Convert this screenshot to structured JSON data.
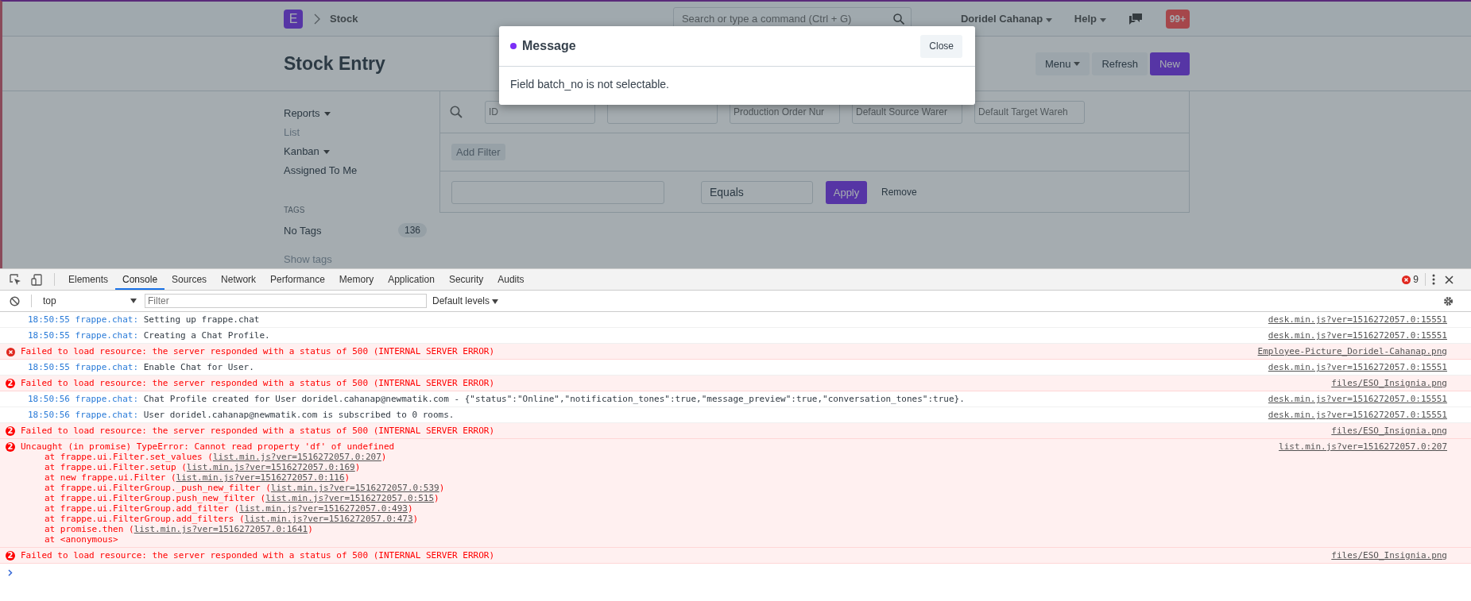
{
  "navbar": {
    "logo": "E",
    "breadcrumb": "Stock",
    "search": {
      "placeholder": "Search or type a command (Ctrl + G)"
    },
    "user": "Doridel Cahanap",
    "help": "Help",
    "notifications": "99+"
  },
  "page": {
    "title": "Stock Entry",
    "buttons": [
      {
        "label": "Menu",
        "kind": "dropdown"
      },
      {
        "label": "Refresh",
        "kind": "default"
      },
      {
        "label": "New",
        "kind": "primary"
      }
    ]
  },
  "sidebar": {
    "items": [
      {
        "label": "Reports",
        "dropdown": true,
        "selected": false
      },
      {
        "label": "List",
        "dropdown": false,
        "selected": true
      },
      {
        "label": "Kanban",
        "dropdown": true,
        "selected": false
      },
      {
        "label": "Assigned To Me",
        "dropdown": false,
        "selected": false
      }
    ],
    "tags_heading": "TAGS",
    "tags": [
      {
        "label": "No Tags",
        "count": "136"
      }
    ],
    "show_tags": "Show tags"
  },
  "list": {
    "standard_filters": [
      {
        "kind": "input",
        "placeholder": "ID"
      },
      {
        "kind": "input"
      },
      {
        "kind": "input",
        "placeholder": "Production Order Nur"
      },
      {
        "kind": "input",
        "placeholder": "Default Source Warer"
      },
      {
        "kind": "input",
        "placeholder": "Default Target Wareh"
      }
    ],
    "add_filter": "Add Filter",
    "filter_row": {
      "condition": "Equals",
      "apply": "Apply",
      "remove": "Remove"
    }
  },
  "modal": {
    "title": "Message",
    "body": "Field batch_no is not selectable.",
    "close": "Close"
  },
  "devtools": {
    "tabs": [
      {
        "label": "Elements",
        "selected": false
      },
      {
        "label": "Console",
        "selected": true
      },
      {
        "label": "Sources",
        "selected": false
      },
      {
        "label": "Network",
        "selected": false
      },
      {
        "label": "Performance",
        "selected": false
      },
      {
        "label": "Memory",
        "selected": false
      },
      {
        "label": "Application",
        "selected": false
      },
      {
        "label": "Security",
        "selected": false
      },
      {
        "label": "Audits",
        "selected": false
      }
    ],
    "error_count": "9",
    "context": "top",
    "filter": {
      "placeholder": "Filter"
    },
    "levels": "Default levels",
    "messages": [
      {
        "kind": "log",
        "time": "18:50:55",
        "source": "frappe.chat:",
        "text": "Setting up frappe.chat",
        "link": "desk.min.js?ver=1516272057.0:15551"
      },
      {
        "kind": "log",
        "time": "18:50:55",
        "source": "frappe.chat:",
        "text": "Creating a Chat Profile.",
        "link": "desk.min.js?ver=1516272057.0:15551"
      },
      {
        "kind": "error",
        "text": "Failed to load resource: the server responded with a status of 500 (INTERNAL SERVER ERROR)",
        "link": "Employee-Picture_Doridel-Cahanap.png"
      },
      {
        "kind": "log",
        "time": "18:50:55",
        "source": "frappe.chat:",
        "text": "Enable Chat for User.",
        "link": "desk.min.js?ver=1516272057.0:15551"
      },
      {
        "kind": "error",
        "count": "2",
        "text": "Failed to load resource: the server responded with a status of 500 (INTERNAL SERVER ERROR)",
        "link": "files/ESO_Insignia.png"
      },
      {
        "kind": "log",
        "time": "18:50:56",
        "source": "frappe.chat:",
        "text": "Chat Profile created for User doridel.cahanap@newmatik.com - {\"status\":\"Online\",\"notification_tones\":true,\"message_preview\":true,\"conversation_tones\":true}.",
        "link": "desk.min.js?ver=1516272057.0:15551"
      },
      {
        "kind": "log",
        "time": "18:50:56",
        "source": "frappe.chat:",
        "text": "User doridel.cahanap@newmatik.com is subscribed to 0 rooms.",
        "link": "desk.min.js?ver=1516272057.0:15551"
      },
      {
        "kind": "error",
        "count": "2",
        "text": "Failed to load resource: the server responded with a status of 500 (INTERNAL SERVER ERROR)",
        "link": "files/ESO_Insignia.png"
      },
      {
        "kind": "error",
        "count": "2",
        "text": "Uncaught (in promise) TypeError: Cannot read property 'df' of undefined",
        "link": "list.min.js?ver=1516272057.0:207",
        "stack": [
          {
            "text": "at frappe.ui.Filter.set_values (",
            "link": "list.min.js?ver=1516272057.0:207",
            "after": ")"
          },
          {
            "text": "at frappe.ui.Filter.setup (",
            "link": "list.min.js?ver=1516272057.0:169",
            "after": ")"
          },
          {
            "text": "at new frappe.ui.Filter (",
            "link": "list.min.js?ver=1516272057.0:116",
            "after": ")"
          },
          {
            "text": "at frappe.ui.FilterGroup._push_new_filter (",
            "link": "list.min.js?ver=1516272057.0:539",
            "after": ")"
          },
          {
            "text": "at frappe.ui.FilterGroup.push_new_filter (",
            "link": "list.min.js?ver=1516272057.0:515",
            "after": ")"
          },
          {
            "text": "at frappe.ui.FilterGroup.add_filter (",
            "link": "list.min.js?ver=1516272057.0:493",
            "after": ")"
          },
          {
            "text": "at frappe.ui.FilterGroup.add_filters (",
            "link": "list.min.js?ver=1516272057.0:473",
            "after": ")"
          },
          {
            "text": "at promise.then (",
            "link": "list.min.js?ver=1516272057.0:1641",
            "after": ")"
          },
          {
            "text": "at <anonymous>"
          }
        ]
      },
      {
        "kind": "error",
        "count": "2",
        "text": "Failed to load resource: the server responded with a status of 500 (INTERNAL SERVER ERROR)",
        "link": "files/ESO_Insignia.png"
      }
    ]
  }
}
